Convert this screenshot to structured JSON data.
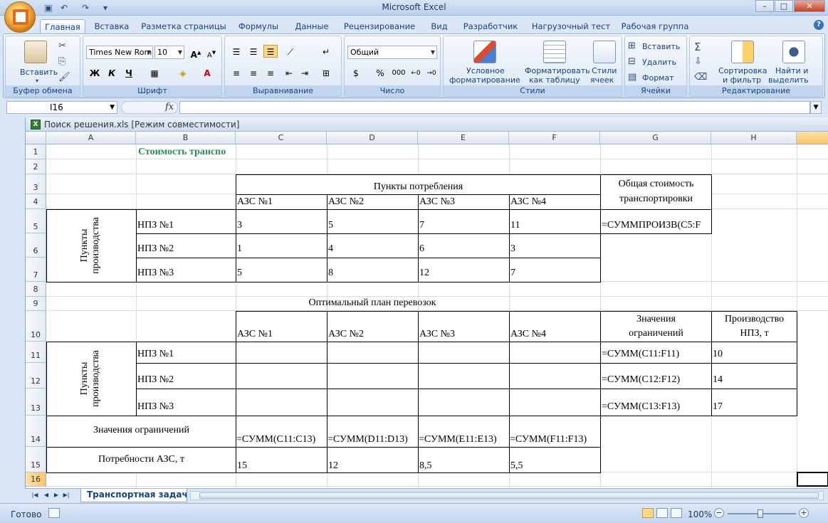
{
  "window": {
    "title": "Microsoft Excel"
  },
  "ribbon_tabs": [
    "Главная",
    "Вставка",
    "Разметка страницы",
    "Формулы",
    "Данные",
    "Рецензирование",
    "Вид",
    "Разработчик",
    "Нагрузочный тест",
    "Рабочая группа"
  ],
  "groups": {
    "clipboard": {
      "title": "Буфер обмена",
      "paste": "Вставить"
    },
    "font": {
      "title": "Шрифт",
      "font_name": "Times New Rom",
      "font_size": "10",
      "bold": "Ж",
      "italic": "К",
      "underline": "Ч"
    },
    "alignment": {
      "title": "Выравнивание"
    },
    "number": {
      "title": "Число",
      "format": "Общий",
      "percent": "%",
      "thousands": "000"
    },
    "styles": {
      "title": "Стили",
      "conditional": "Условное",
      "conditional2": "форматирование",
      "as_table": "Форматировать",
      "as_table2": "как таблицу",
      "cell_styles": "Стили",
      "cell_styles2": "ячеек"
    },
    "cells": {
      "title": "Ячейки",
      "insert": "Вставить",
      "delete": "Удалить",
      "format": "Формат"
    },
    "editing": {
      "title": "Редактирование",
      "sort": "Сортировка",
      "sort2": "и фильтр",
      "find": "Найти и",
      "find2": "выделить"
    }
  },
  "formula_bar": {
    "name_box": "I16",
    "fx": "fx",
    "value": ""
  },
  "workbook": {
    "title": "Поиск решения.xls  [Режим совместимости]"
  },
  "columns": [
    "A",
    "B",
    "C",
    "D",
    "E",
    "F",
    "G",
    "H"
  ],
  "rows": [
    "1",
    "2",
    "3",
    "4",
    "5",
    "6",
    "7",
    "8",
    "9",
    "10",
    "11",
    "12",
    "13",
    "14",
    "15",
    "16"
  ],
  "sheet": {
    "title": "Стоимость транспо",
    "consumption_points": "Пункты потребления",
    "total_cost_1": "Общая стоимость",
    "total_cost_2": "транспортировки",
    "production_points_1": "Пункты",
    "production_points_2": "производства",
    "azs": [
      "АЗС №1",
      "АЗС №2",
      "АЗС №3",
      "АЗС №4"
    ],
    "npz": [
      "НПЗ №1",
      "НПЗ №2",
      "НПЗ №3"
    ],
    "costs": [
      [
        "3",
        "5",
        "7",
        "11"
      ],
      [
        "1",
        "4",
        "6",
        "3"
      ],
      [
        "5",
        "8",
        "12",
        "7"
      ]
    ],
    "total_formula": "=СУММПРОИЗВ(C5:F",
    "optimal_plan": "Оптимальный план перевозок",
    "constraint_values_1": "Значения",
    "constraint_values_2": "ограничений",
    "production_1": "Производство",
    "production_2": "НПЗ, т",
    "row_sums": [
      "=СУММ(C11:F11)",
      "=СУММ(C12:F12)",
      "=СУММ(C13:F13)"
    ],
    "production_values": [
      "10",
      "14",
      "17"
    ],
    "constraint_row_label": "Значения ограничений",
    "col_sums": [
      "=СУММ(C11:C13)",
      "=СУММ(D11:D13)",
      "=СУММ(E11:E13)",
      "=СУММ(F11:F13)"
    ],
    "demand_label": "Потребности АЗС, т",
    "demand": [
      "15",
      "12",
      "8,5",
      "5,5"
    ]
  },
  "sheet_tab": "Транспортная задача",
  "status": {
    "ready": "Готово",
    "zoom": "100%"
  }
}
